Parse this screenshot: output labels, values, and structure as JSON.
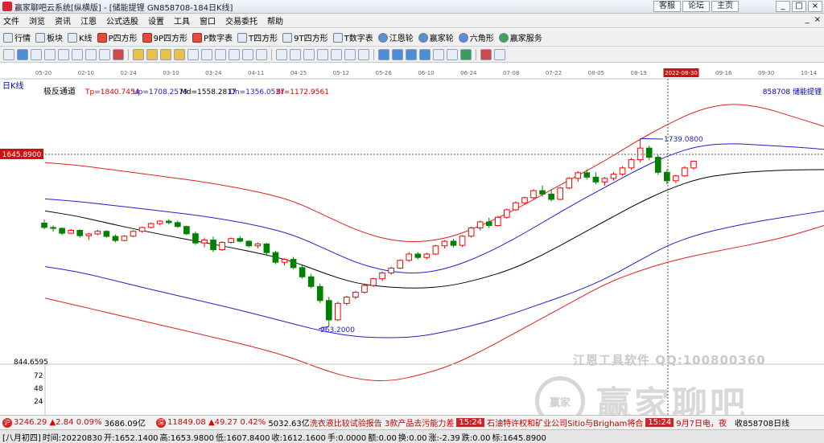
{
  "window": {
    "title": "赢家聊吧云系统[纵横版] - [储能提锂 GN858708-184日K线]",
    "links": [
      "客服",
      "论坛",
      "主页"
    ],
    "controls": [
      "_",
      "□",
      "×"
    ]
  },
  "menu": {
    "items": [
      "文件",
      "浏览",
      "资讯",
      "江恩",
      "公式选股",
      "设置",
      "工具",
      "窗口",
      "交易委托",
      "帮助"
    ],
    "right": [
      "_",
      "×"
    ]
  },
  "toolbar": {
    "items": [
      {
        "label": "行情",
        "icon": "quote-icon"
      },
      {
        "label": "板块",
        "icon": "sector-icon"
      },
      {
        "label": "K线",
        "icon": "kline-icon"
      },
      {
        "label": "P四方形",
        "icon": "p-square-icon"
      },
      {
        "label": "9P四方形",
        "icon": "9p-square-icon"
      },
      {
        "label": "P数字表",
        "icon": "p-number-table-icon"
      },
      {
        "label": "T四方形",
        "icon": "t-square-icon"
      },
      {
        "label": "9T四方形",
        "icon": "9t-square-icon"
      },
      {
        "label": "T数字表",
        "icon": "t-number-table-icon"
      },
      {
        "label": "江恩轮",
        "icon": "gann-wheel-icon"
      },
      {
        "label": "赢家轮",
        "icon": "winner-wheel-icon"
      },
      {
        "label": "六角形",
        "icon": "hexagon-icon"
      },
      {
        "label": "赢家服务",
        "icon": "winner-service-icon"
      }
    ]
  },
  "chart": {
    "period_label": "日K线",
    "indicator_name": "极反通道",
    "legend": {
      "tp": "Tp=1840.7454",
      "up": "Up=1708.2579",
      "md": "Md=1558.2817",
      "dn": "Dn=1356.0537",
      "bt": "Bt=1172.9561"
    },
    "code_label": "858708  储能提锂",
    "price_tag": "1645.8900",
    "high_label": "1739.0800",
    "low_label": "963.2000",
    "date_axis": [
      "05-20",
      "02-10",
      "02-24",
      "03-10",
      "03-24",
      "04-11",
      "04-25",
      "05-12",
      "05-26",
      "06-10",
      "06-24",
      "07-08",
      "07-22",
      "08-05",
      "08-19",
      "2022-08-30",
      "09-16",
      "09-30",
      "10-14"
    ],
    "volume_axis": [
      "844.6595",
      "72",
      "48",
      "24"
    ],
    "colors": {
      "up": "#ff0000",
      "down": "#008000",
      "tp_bt": "#e02020",
      "up_dn": "#2020d0",
      "md": "#000000"
    }
  },
  "chart_data": {
    "type": "candlestick",
    "series": [
      {
        "name": "Tp",
        "values": [
          1640,
          1630,
          1613,
          1596,
          1579,
          1562,
          1540,
          1515,
          1480,
          1420,
          1360,
          1320,
          1310,
          1330,
          1380,
          1440,
          1510,
          1580,
          1650,
          1730,
          1800,
          1860,
          1885,
          1870,
          1830,
          1790
        ]
      },
      {
        "name": "Up",
        "values": [
          1490,
          1480,
          1466,
          1451,
          1436,
          1420,
          1400,
          1375,
          1340,
          1283,
          1225,
          1190,
          1180,
          1205,
          1255,
          1320,
          1395,
          1470,
          1540,
          1610,
          1670,
          1710,
          1720,
          1712,
          1705,
          1695
        ]
      },
      {
        "name": "Md",
        "values": [
          1440,
          1420,
          1390,
          1362,
          1336,
          1312,
          1288,
          1262,
          1230,
          1180,
          1140,
          1125,
          1120,
          1130,
          1160,
          1200,
          1260,
          1330,
          1400,
          1470,
          1530,
          1575,
          1595,
          1605,
          1610,
          1611
        ]
      },
      {
        "name": "Dn",
        "values": [
          1210,
          1190,
          1160,
          1128,
          1098,
          1068,
          1038,
          1006,
          972,
          940,
          920,
          915,
          920,
          945,
          975,
          1015,
          1060,
          1105,
          1160,
          1230,
          1300,
          1345,
          1375,
          1400,
          1420,
          1440
        ]
      },
      {
        "name": "Bt",
        "values": [
          1080,
          1050,
          1020,
          990,
          960,
          930,
          900,
          868,
          830,
          780,
          745,
          735,
          760,
          800,
          860,
          930,
          1000,
          1070,
          1140,
          1190,
          1230,
          1260,
          1285,
          1310,
          1340,
          1380
        ]
      }
    ],
    "ohlc": [
      [
        1390,
        1405,
        1365,
        1372
      ],
      [
        1372,
        1380,
        1355,
        1368
      ],
      [
        1368,
        1372,
        1340,
        1348
      ],
      [
        1348,
        1366,
        1345,
        1360
      ],
      [
        1360,
        1364,
        1330,
        1338
      ],
      [
        1338,
        1350,
        1320,
        1345
      ],
      [
        1345,
        1362,
        1340,
        1356
      ],
      [
        1356,
        1360,
        1330,
        1335
      ],
      [
        1335,
        1343,
        1310,
        1318
      ],
      [
        1318,
        1340,
        1315,
        1336
      ],
      [
        1336,
        1360,
        1332,
        1356
      ],
      [
        1356,
        1375,
        1350,
        1372
      ],
      [
        1372,
        1392,
        1368,
        1388
      ],
      [
        1388,
        1402,
        1380,
        1398
      ],
      [
        1398,
        1406,
        1385,
        1392
      ],
      [
        1392,
        1400,
        1370,
        1376
      ],
      [
        1376,
        1380,
        1340,
        1346
      ],
      [
        1346,
        1355,
        1300,
        1308
      ],
      [
        1308,
        1330,
        1290,
        1320
      ],
      [
        1320,
        1334,
        1270,
        1280
      ],
      [
        1280,
        1315,
        1275,
        1310
      ],
      [
        1310,
        1330,
        1305,
        1326
      ],
      [
        1326,
        1336,
        1310,
        1315
      ],
      [
        1315,
        1320,
        1290,
        1296
      ],
      [
        1296,
        1310,
        1285,
        1304
      ],
      [
        1304,
        1308,
        1260,
        1268
      ],
      [
        1268,
        1275,
        1220,
        1228
      ],
      [
        1228,
        1245,
        1215,
        1240
      ],
      [
        1240,
        1250,
        1200,
        1206
      ],
      [
        1206,
        1215,
        1160,
        1168
      ],
      [
        1168,
        1180,
        1120,
        1128
      ],
      [
        1128,
        1140,
        1060,
        1070
      ],
      [
        1070,
        1085,
        963,
        990
      ],
      [
        990,
        1065,
        985,
        1058
      ],
      [
        1058,
        1090,
        1050,
        1084
      ],
      [
        1084,
        1110,
        1075,
        1104
      ],
      [
        1104,
        1140,
        1098,
        1132
      ],
      [
        1132,
        1165,
        1125,
        1160
      ],
      [
        1160,
        1190,
        1150,
        1184
      ],
      [
        1184,
        1210,
        1176,
        1204
      ],
      [
        1204,
        1240,
        1200,
        1236
      ],
      [
        1236,
        1270,
        1230,
        1262
      ],
      [
        1262,
        1270,
        1240,
        1248
      ],
      [
        1248,
        1268,
        1240,
        1262
      ],
      [
        1262,
        1300,
        1258,
        1296
      ],
      [
        1296,
        1320,
        1285,
        1315
      ],
      [
        1315,
        1325,
        1290,
        1298
      ],
      [
        1298,
        1340,
        1292,
        1336
      ],
      [
        1336,
        1375,
        1330,
        1370
      ],
      [
        1370,
        1400,
        1360,
        1395
      ],
      [
        1395,
        1412,
        1370,
        1380
      ],
      [
        1380,
        1420,
        1376,
        1414
      ],
      [
        1414,
        1450,
        1408,
        1445
      ],
      [
        1445,
        1480,
        1440,
        1474
      ],
      [
        1474,
        1500,
        1465,
        1495
      ],
      [
        1495,
        1530,
        1488,
        1524
      ],
      [
        1524,
        1545,
        1500,
        1510
      ],
      [
        1510,
        1530,
        1480,
        1488
      ],
      [
        1488,
        1540,
        1485,
        1535
      ],
      [
        1535,
        1580,
        1530,
        1575
      ],
      [
        1575,
        1605,
        1560,
        1598
      ],
      [
        1598,
        1612,
        1570,
        1580
      ],
      [
        1580,
        1600,
        1550,
        1560
      ],
      [
        1560,
        1580,
        1545,
        1575
      ],
      [
        1575,
        1600,
        1565,
        1592
      ],
      [
        1592,
        1625,
        1585,
        1618
      ],
      [
        1618,
        1660,
        1610,
        1652
      ],
      [
        1652,
        1739.08,
        1640,
        1700
      ],
      [
        1700,
        1710,
        1650,
        1662
      ],
      [
        1662,
        1672,
        1590,
        1600
      ],
      [
        1600,
        1612,
        1550,
        1565
      ],
      [
        1565,
        1590,
        1555,
        1585
      ],
      [
        1585,
        1625,
        1580,
        1618
      ],
      [
        1618,
        1648,
        1610,
        1645.89
      ]
    ],
    "xlabel": "",
    "ylabel": ""
  },
  "ticker": {
    "sh_index": "3246.29",
    "sh_change": "▲2.84",
    "sh_pct": "0.09%",
    "sh_amount": "3686.09亿",
    "sz_index": "11849.08",
    "sz_change": "▲49.27",
    "sz_pct": "0.42%",
    "sz_amount": "5032.63亿",
    "news1": "洗衣液比较试验报告 3款产品去污能力差",
    "time1": "15:24",
    "news2": "石油特许权和矿业公司Sitio与Brigham将合",
    "time2": "15:24",
    "news3": "9月7日电，夜",
    "right_label": "收858708日线"
  },
  "status": {
    "lunar": "[八月初四]",
    "time": "时间:20220830",
    "open": "开:1652.1400",
    "high": "高:1653.9800",
    "close": "低:1607.8400",
    "low": "收:1612.1600",
    "hand": "手:0.0000",
    "amount": "额:0.00",
    "change": "换:0.00",
    "diff": "涨:-2.39",
    "turnover": "跌:0.00",
    "mark": "标:1645.8900"
  }
}
